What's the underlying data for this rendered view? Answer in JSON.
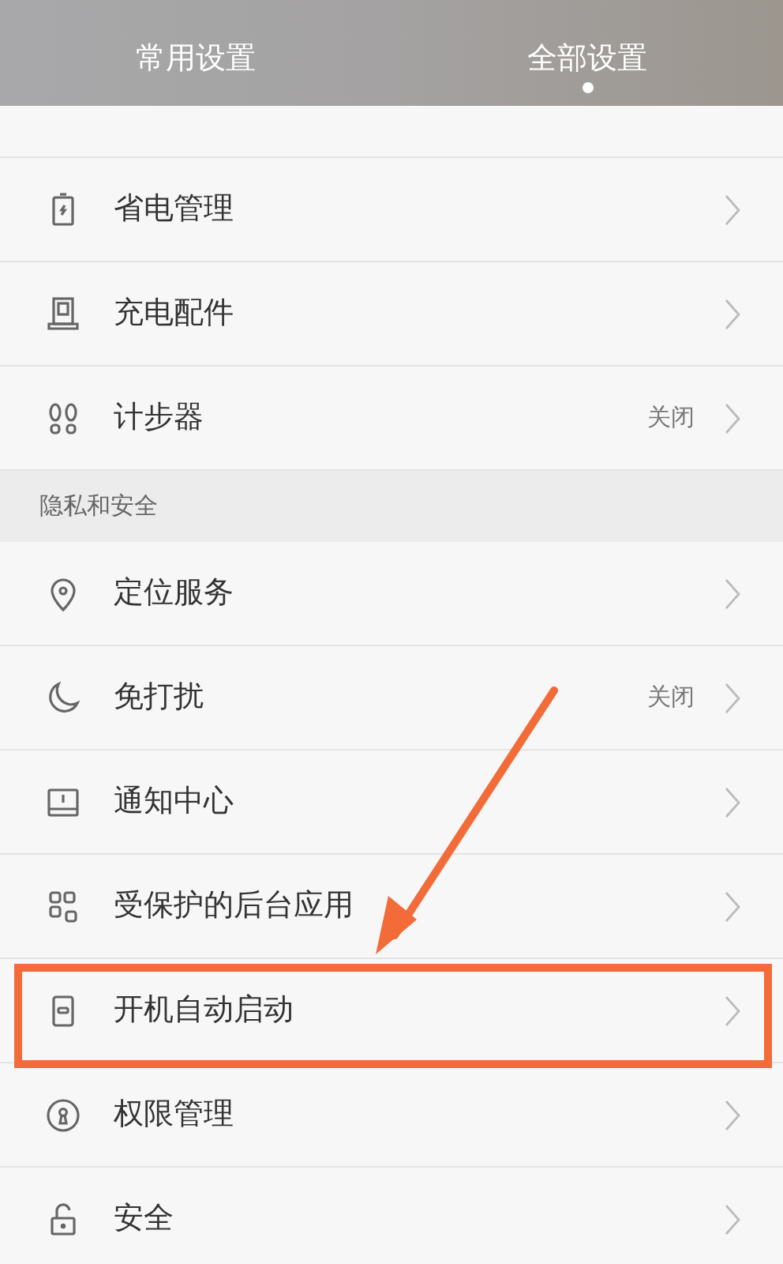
{
  "tabs": [
    {
      "label": "常用设置",
      "selected": false
    },
    {
      "label": "全部设置",
      "selected": true
    }
  ],
  "groups": [
    {
      "items": [
        {
          "label": "省电管理",
          "highlighted": false
        },
        {
          "label": "充电配件",
          "highlighted": false
        },
        {
          "label": "计步器",
          "value": "关闭",
          "highlighted": false
        }
      ]
    },
    {
      "title": "隐私和安全",
      "items": [
        {
          "label": "定位服务",
          "highlighted": false
        },
        {
          "label": "免打扰",
          "value": "关闭",
          "highlighted": false
        },
        {
          "label": "通知中心",
          "highlighted": false
        },
        {
          "label": "受保护的后台应用",
          "highlighted": false
        },
        {
          "label": "开机自动启动",
          "highlighted": true
        },
        {
          "label": "权限管理",
          "highlighted": false
        },
        {
          "label": "安全",
          "highlighted": false
        }
      ]
    }
  ]
}
